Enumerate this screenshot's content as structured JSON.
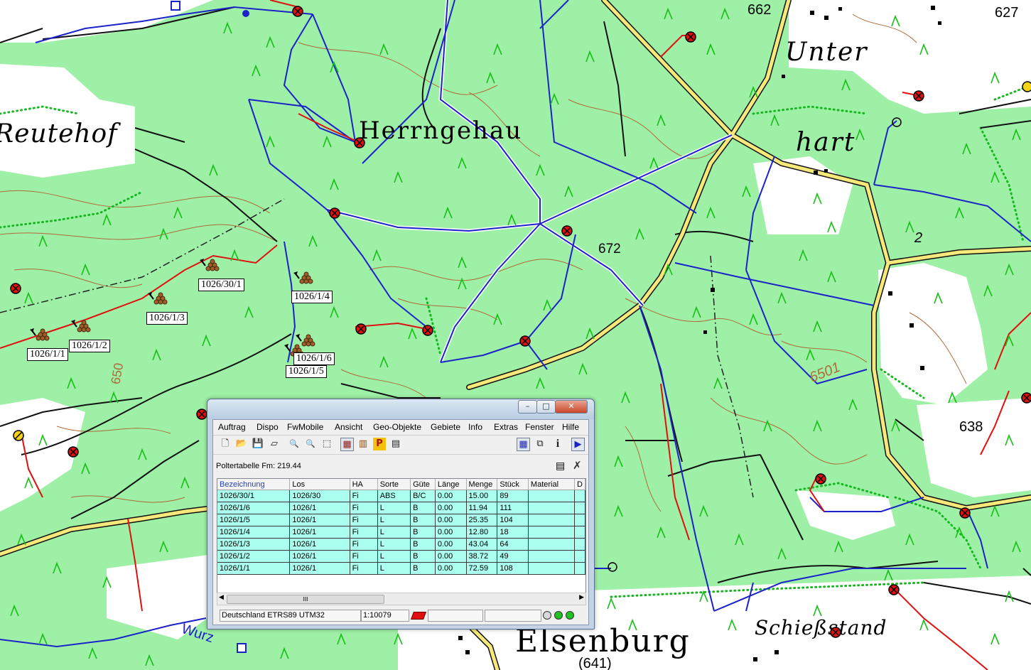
{
  "map": {
    "place_names": [
      "Herrngehau",
      "Unter",
      "hart",
      "Reutehof",
      "Elsenburg",
      "Schießstand"
    ],
    "elevations": [
      "662",
      "627",
      "672",
      "650",
      "6501",
      "638",
      "2",
      "(641)",
      "Wurz"
    ],
    "polter_labels": [
      "1026/30/1",
      "1026/1/4",
      "1026/1/3",
      "1026/1/2",
      "1026/1/1",
      "1026/1/6",
      "1026/1/5"
    ]
  },
  "window": {
    "minimize_glyph": "–",
    "maximize_glyph": "□",
    "close_glyph": "✕",
    "menu": [
      "Auftrag",
      "Dispo",
      "FwMobile",
      "Ansicht",
      "Geo-Objekte",
      "Gebiete",
      "Info",
      "Extras",
      "Fenster",
      "Hilfe"
    ],
    "toolbar": {
      "new": "🗋",
      "open": "📂",
      "save": "💾",
      "print": "▱",
      "zoom_in": "🔍",
      "zoom_out": "🔍",
      "select": "⬚",
      "poltertabelle": "▦",
      "holz": "▥",
      "p": "P",
      "grid": "▤",
      "map_view": "▦",
      "copy": "⧉",
      "info": "i",
      "play": "▶"
    },
    "poltertabelle_title": "Poltertabelle Fm: 219.44",
    "columns": [
      "Bezeichnung",
      "Los",
      "HA",
      "Sorte",
      "Güte",
      "Länge",
      "Menge",
      "Stück",
      "Material",
      "D"
    ],
    "rows": [
      [
        "1026/30/1",
        "1026/30",
        "Fi",
        "ABS",
        "B/C",
        "0.00",
        "15.00",
        "89",
        ""
      ],
      [
        "1026/1/6",
        "1026/1",
        "Fi",
        "L",
        "B",
        "0.00",
        "11.94",
        "111",
        ""
      ],
      [
        "1026/1/5",
        "1026/1",
        "Fi",
        "L",
        "B",
        "0.00",
        "25.35",
        "104",
        ""
      ],
      [
        "1026/1/4",
        "1026/1",
        "Fi",
        "L",
        "B",
        "0.00",
        "12.80",
        "18",
        ""
      ],
      [
        "1026/1/3",
        "1026/1",
        "Fi",
        "L",
        "B",
        "0.00",
        "43.04",
        "64",
        ""
      ],
      [
        "1026/1/2",
        "1026/1",
        "Fi",
        "L",
        "B",
        "0.00",
        "38.72",
        "49",
        ""
      ],
      [
        "1026/1/1",
        "1026/1",
        "Fi",
        "L",
        "B",
        "0.00",
        "72.59",
        "108",
        ""
      ]
    ],
    "scroll_thumb_grip": "III",
    "status": {
      "coordinate_system": "Deutschland ETRS89 UTM32",
      "scale": "1:10079"
    }
  }
}
